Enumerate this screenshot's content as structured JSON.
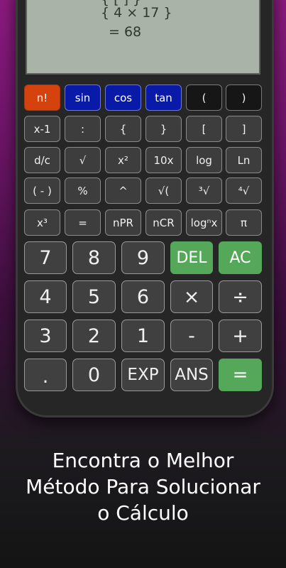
{
  "display": {
    "line_top": "{ [ ] }",
    "expression": "{ 4 × 17 }",
    "result": "=  68"
  },
  "keys": {
    "row1": [
      "n!",
      "sin",
      "cos",
      "tan",
      "(",
      ")"
    ],
    "row2": [
      "x-1",
      ":",
      "{",
      "}",
      "[",
      "]"
    ],
    "row3": [
      "d/c",
      "√",
      "x²",
      "10x",
      "log",
      "Ln"
    ],
    "row4": [
      "( - )",
      "%",
      "^",
      "√(",
      "³√",
      "⁴√"
    ],
    "row5": [
      "x³",
      "=",
      "nPR",
      "nCR",
      "logⁿx",
      "π"
    ],
    "row6": [
      "7",
      "8",
      "9",
      "DEL",
      "AC"
    ],
    "row7": [
      "4",
      "5",
      "6",
      "×",
      "÷"
    ],
    "row8": [
      "3",
      "2",
      "1",
      "-",
      "+"
    ],
    "row9": [
      ".",
      "0",
      "EXP",
      "ANS",
      "="
    ]
  },
  "caption": {
    "line1": "Encontra o Melhor",
    "line2": "Método Para Solucionar",
    "line3": "o Cálculo"
  },
  "colors": {
    "factorial_key": "#d6420e",
    "trig_keys": "#0a1aa8",
    "paren_keys": "#161616",
    "green_keys": "#55a85a",
    "display_bg": "#a9b3a8"
  }
}
